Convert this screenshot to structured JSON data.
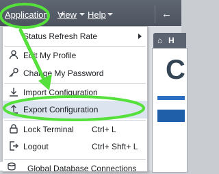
{
  "menubar": {
    "items": [
      {
        "label": "Application"
      },
      {
        "label": "View"
      },
      {
        "label": "Help"
      }
    ]
  },
  "home_tab": {
    "label": "H"
  },
  "content": {
    "big_letter": "C"
  },
  "menu": {
    "items": [
      {
        "label": "Status Refresh Rate",
        "shortcut": "",
        "icon": "none",
        "has_submenu": true
      },
      {
        "label": "Edit My Profile",
        "shortcut": "",
        "icon": "user-icon"
      },
      {
        "label": "Change My Password",
        "shortcut": "",
        "icon": "key-icon"
      },
      {
        "label": "Import Configuration",
        "shortcut": "",
        "icon": "download-icon"
      },
      {
        "label": "Export Configuration",
        "shortcut": "",
        "icon": "upload-icon",
        "highlighted": true
      },
      {
        "label": "Lock Terminal",
        "shortcut": "Ctrl+ L",
        "icon": "lock-icon"
      },
      {
        "label": "Logout",
        "shortcut": "Ctrl+ Shft+ L",
        "icon": "logout-icon"
      },
      {
        "label": "Global Database Connections",
        "shortcut": "",
        "icon": "database-icon"
      }
    ]
  },
  "colors": {
    "menubar_bg": "#555c67",
    "highlight_bg": "#dbe4ef",
    "annotation_green": "#55e03c"
  }
}
